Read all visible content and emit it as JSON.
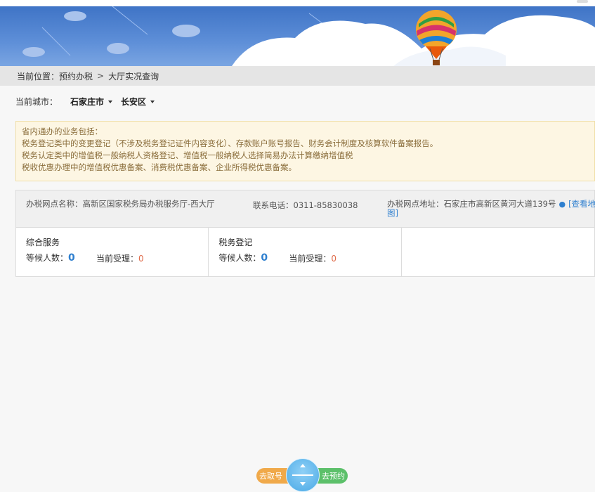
{
  "breadcrumb": {
    "prefix": "当前位置：预约办税",
    "separator": ">",
    "current": "大厅实况查询"
  },
  "city": {
    "label": "当前城市：",
    "city": "石家庄市",
    "district": "长安区"
  },
  "notice": {
    "lines": [
      "省内通办的业务包括：",
      "税务登记类中的变更登记（不涉及税务登记证件内容变化）、存款账户账号报告、财务会计制度及核算软件备案报告。",
      "税务认定类中的增值税一般纳税人资格登记、增值税一般纳税人选择简易办法计算缴纳增值税",
      "税收优惠办理中的增值税优惠备案、消费税优惠备案、企业所得税优惠备案。"
    ]
  },
  "office": {
    "name": "办税网点名称：高新区国家税务局办税服务厅-西大厅",
    "phone": "联系电话：0311-85830038",
    "address": "办税网点地址：石家庄市高新区黄河大道139号",
    "map_link": "[查看地图]"
  },
  "queues": [
    {
      "title": "综合服务",
      "waiting_label": "等候人数：",
      "waiting": "0",
      "current_label": "当前受理：",
      "current": "0"
    },
    {
      "title": "税务登记",
      "waiting_label": "等候人数：",
      "waiting": "0",
      "current_label": "当前受理：",
      "current": "0"
    }
  ],
  "bottom": {
    "left_label": "去取号",
    "right_label": "去预约"
  },
  "colors": {
    "accent_blue": "#2e7fcf",
    "orange_button": "#f0a94a",
    "green_button": "#5cc06a",
    "notice_bg": "#fdf6e3"
  }
}
